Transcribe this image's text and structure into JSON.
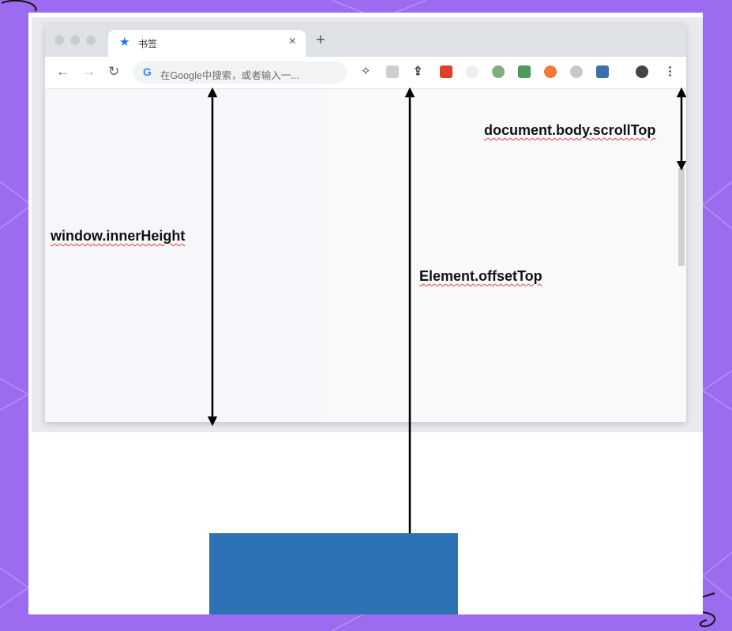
{
  "browser": {
    "tab": {
      "title": "书签",
      "close": "×",
      "icon": "star-icon"
    },
    "new_tab": "+",
    "omnibox": {
      "placeholder": "在Google中搜索，或者输入一..."
    },
    "extensions": [
      "puzzle-icon",
      "reader-icon",
      "upload-icon",
      "fe-extension-icon",
      "clock-extension-icon",
      "green-circle-extension-icon",
      "green-badge-extension-icon",
      "orange-x-extension-icon",
      "gray-face-extension-icon",
      "blue-printer-extension-icon",
      "profile-icon",
      "menu-icon"
    ]
  },
  "labels": {
    "inner_height": "window.innerHeight",
    "offset_top": "Element.offsetTop",
    "scroll_top": "document.body.scrollTop"
  },
  "colors": {
    "background": "#9b6cf0",
    "element": "#2d72b4",
    "tab_star": "#1a73e8"
  }
}
